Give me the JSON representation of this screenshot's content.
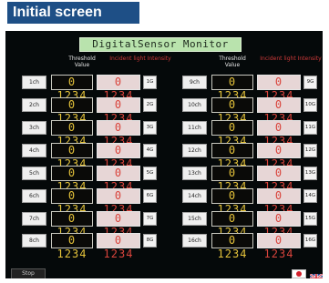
{
  "caption": "Initial screen",
  "app_title": "DigitalSensor Monitor",
  "header": {
    "threshold": "Threshold Value",
    "incident": "Incident light Intensity"
  },
  "channels_left": [
    {
      "ch": "1ch",
      "threshold": "0 1234",
      "intensity": "0 1234",
      "sg": "1G"
    },
    {
      "ch": "2ch",
      "threshold": "0 1234",
      "intensity": "0 1234",
      "sg": "2G"
    },
    {
      "ch": "3ch",
      "threshold": "0 1234",
      "intensity": "0 1234",
      "sg": "3G"
    },
    {
      "ch": "4ch",
      "threshold": "0 1234",
      "intensity": "0 1234",
      "sg": "4G"
    },
    {
      "ch": "5ch",
      "threshold": "0 1234",
      "intensity": "0 1234",
      "sg": "5G"
    },
    {
      "ch": "6ch",
      "threshold": "0 1234",
      "intensity": "0 1234",
      "sg": "6G"
    },
    {
      "ch": "7ch",
      "threshold": "0 1234",
      "intensity": "0 1234",
      "sg": "7G"
    },
    {
      "ch": "8ch",
      "threshold": "0 1234",
      "intensity": "0 1234",
      "sg": "8G"
    }
  ],
  "channels_right": [
    {
      "ch": "9ch",
      "threshold": "0 1234",
      "intensity": "0 1234",
      "sg": "9G"
    },
    {
      "ch": "10ch",
      "threshold": "0 1234",
      "intensity": "0 1234",
      "sg": "10G"
    },
    {
      "ch": "11ch",
      "threshold": "0 1234",
      "intensity": "0 1234",
      "sg": "11G"
    },
    {
      "ch": "12ch",
      "threshold": "0 1234",
      "intensity": "0 1234",
      "sg": "12G"
    },
    {
      "ch": "13ch",
      "threshold": "0 1234",
      "intensity": "0 1234",
      "sg": "13G"
    },
    {
      "ch": "14ch",
      "threshold": "0 1234",
      "intensity": "0 1234",
      "sg": "14G"
    },
    {
      "ch": "15ch",
      "threshold": "0 1234",
      "intensity": "0 1234",
      "sg": "15G"
    },
    {
      "ch": "16ch",
      "threshold": "0 1234",
      "intensity": "0 1234",
      "sg": "16G"
    }
  ],
  "footer": {
    "stop_label": "Stop",
    "flags": [
      "japan-flag-icon",
      "uk-flag-icon"
    ]
  },
  "colors": {
    "threshold_digits": "#e4c23a",
    "intensity_digits": "#d9443c",
    "title_bg": "#b9e3ad",
    "caption_bg": "#1e4f86"
  }
}
